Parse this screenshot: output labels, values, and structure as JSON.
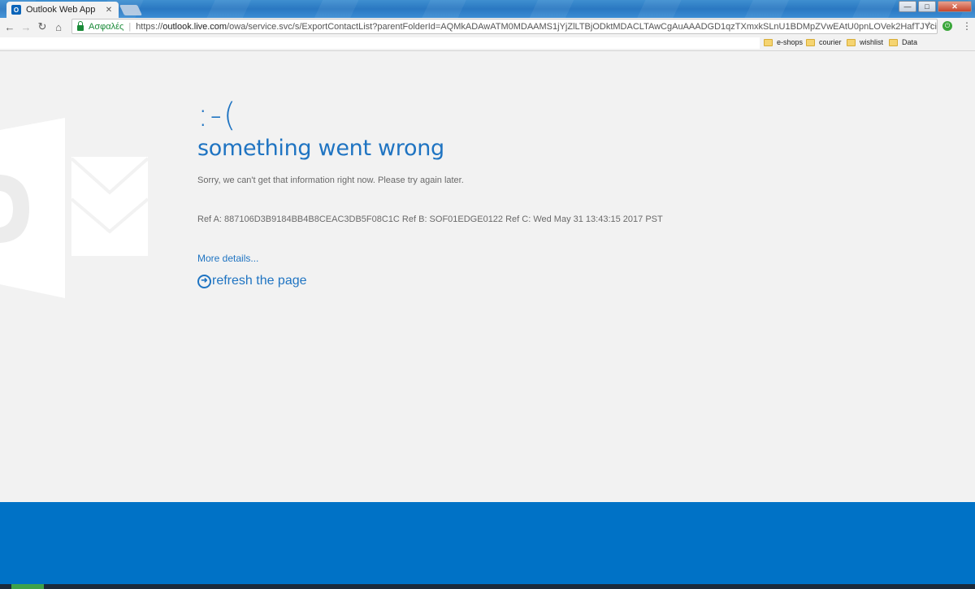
{
  "browser": {
    "tab_title": "Outlook Web App",
    "tab_favicon": "O",
    "close_glyph": "✕",
    "window_controls": {
      "minimize": "—",
      "maximize": "□",
      "close": "✕"
    },
    "nav": {
      "back": "←",
      "forward": "→",
      "reload": "↻",
      "home": "⌂"
    },
    "secure_label": "Ασφαλές",
    "separator": "|",
    "url_scheme": "https://",
    "url_host": "outlook.live.com",
    "url_path": "/owa/service.svc/s/ExportContactList?parentFolderId=AQMkADAwATM0MDAAMS1jYjZlLTBjODktMDACLTAwCgAuAAADGD1qzTXmxkSLnU1BDMpZVwEAtU0pnLOVek2HafTJYciUKwAAAgEOAAAA",
    "star_glyph": "☆",
    "extension_glyph": "⏻",
    "menu_glyph": "⋮",
    "bookmarks": [
      "e-shops",
      "courier",
      "wishlist",
      "Data"
    ]
  },
  "error": {
    "smiley": ":-(",
    "headline": "something went wrong",
    "message": "Sorry, we can't get that information right now. Please try again later.",
    "refs": "Ref A: 887106D3B9184BB4B8CEAC3DB5F08C1C Ref B: SOF01EDGE0122 Ref C: Wed May 31 13:43:15 2017 PST",
    "more_details": "More details...",
    "refresh_glyph": "➜",
    "refresh_label": "refresh the page"
  },
  "colors": {
    "accent": "#1f74c2",
    "footer": "#0072c6",
    "background": "#f2f2f2",
    "muted_text": "#6a6a6a"
  },
  "icons": [
    "outlook-favicon-icon",
    "lock-icon",
    "star-icon",
    "folder-icon",
    "outlook-logo-icon",
    "refresh-arrow-icon"
  ]
}
